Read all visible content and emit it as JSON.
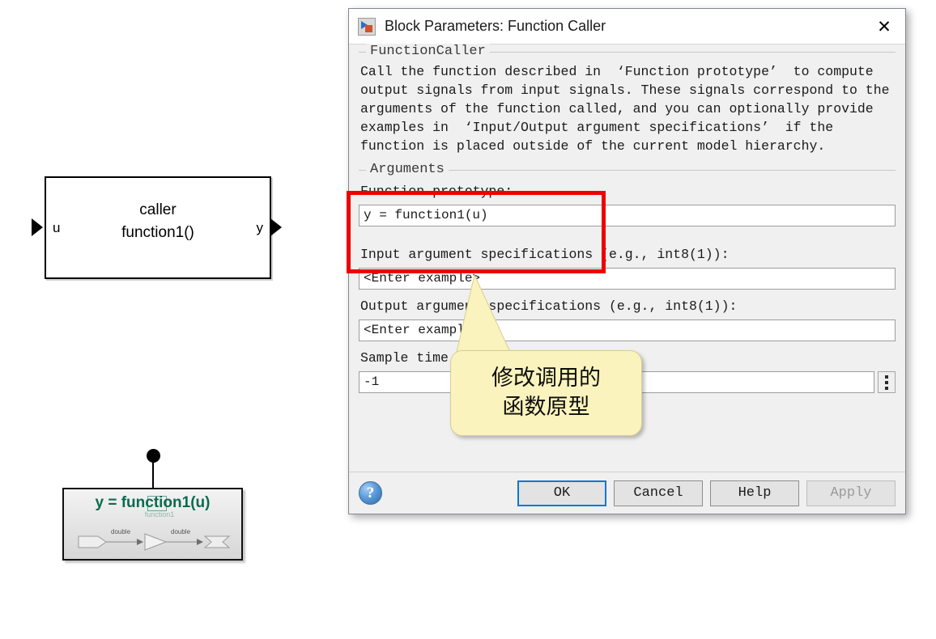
{
  "canvas": {
    "caller_block": {
      "name": "function-caller-block",
      "line1": "caller",
      "line2": "function1()",
      "input_port_label": "u",
      "output_port_label": "y"
    },
    "simulink_function_block": {
      "title": "y = function1(u)",
      "trigger_label": "function1",
      "signal_type_1": "double",
      "signal_type_2": "double"
    }
  },
  "dialog": {
    "title": "Block Parameters: Function Caller",
    "close_label": "✕",
    "description_group": {
      "legend": "FunctionCaller",
      "text": "Call the function described in  ‘Function prototype’  to compute\noutput signals from input signals. These signals correspond to the\narguments of the function called, and you can optionally provide\nexamples in  ‘Input/Output argument specifications’  if the\nfunction is placed outside of the current model hierarchy."
    },
    "arguments_group": {
      "legend": "Arguments",
      "function_prototype_label": "Function prototype:",
      "function_prototype_value": "y = function1(u)",
      "input_args_label": "Input argument specifications (e.g., int8(1)):",
      "input_args_value": "<Enter example>",
      "output_args_label": "Output argument specifications (e.g., int8(1)):",
      "output_args_value": "<Enter example>",
      "sample_time_label": "Sample time (-1 for inherited):",
      "sample_time_value": "-1"
    },
    "footer": {
      "help_orb": "?",
      "ok": "OK",
      "cancel": "Cancel",
      "help": "Help",
      "apply": "Apply"
    }
  },
  "annotations": {
    "highlight_color": "#ee0000",
    "callout": {
      "line1": "修改调用的",
      "line2": "函数原型",
      "fill": "#fbf3bd"
    }
  }
}
